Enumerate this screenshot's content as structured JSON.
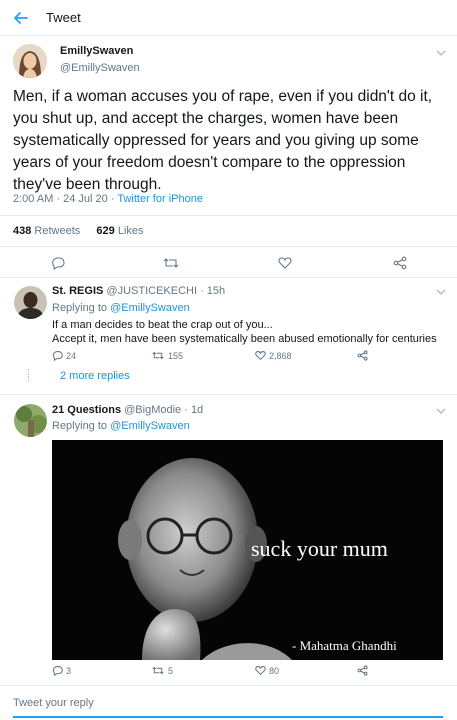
{
  "header": {
    "title": "Tweet"
  },
  "tweet": {
    "name": "EmillySwaven",
    "handle": "@EmillySwaven",
    "text": "Men, if a woman accuses you of rape, even if you didn't do it, you shut up, and accept the charges, women have been systematically oppressed for years and you giving up some years of your freedom doesn't compare to the oppression they've been through.",
    "time": "2:00 AM · 24 Jul 20 · ",
    "source": "Twitter for iPhone",
    "retweets_count": "438",
    "retweets_label": " Retweets",
    "likes_count": "629",
    "likes_label": " Likes"
  },
  "replies": [
    {
      "name": "St. REGIS",
      "handle": "@JUSTICEKECHI · 15h",
      "replying_prefix": "Replying to ",
      "replying_to": "@EmillySwaven",
      "text_line1": "If a man decides to beat the crap out of you...",
      "text_line2": "Accept it, men have been systematically been abused emotionally for centuries",
      "reply_count": "24",
      "retweet_count": "155",
      "like_count": "2,868",
      "more_replies": "2 more replies"
    },
    {
      "name": "21 Questions",
      "handle": "@BigModie · 1d",
      "replying_prefix": "Replying to ",
      "replying_to": "@EmillySwaven",
      "image_caption": "suck your mum",
      "image_attribution": "- Mahatma Ghandhi",
      "reply_count": "3",
      "retweet_count": "5",
      "like_count": "80"
    }
  ],
  "compose": {
    "placeholder": "Tweet your reply"
  },
  "colors": {
    "accent": "#1da1f2",
    "link": "#1b95e0",
    "secondary_text": "#657786",
    "divider": "#e1e8ed"
  }
}
